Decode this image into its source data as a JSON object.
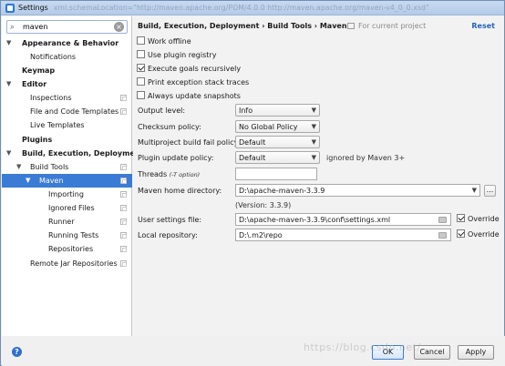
{
  "window": {
    "title": "Settings",
    "title_ghost_text": "xml.schemaLocation=\"http://maven.apache.org/POM/4.0.0 http://maven.apache.org/maven-v4_0_0.xsd\""
  },
  "search": {
    "value": "maven"
  },
  "tree": {
    "appearance_behavior": "Appearance & Behavior",
    "notifications": "Notifications",
    "keymap": "Keymap",
    "editor": "Editor",
    "inspections": "Inspections",
    "file_code_templates": "File and Code Templates",
    "live_templates": "Live Templates",
    "plugins": "Plugins",
    "build_exec_deploy": "Build, Execution, Deployment",
    "build_tools": "Build Tools",
    "maven": "Maven",
    "importing": "Importing",
    "ignored_files": "Ignored Files",
    "runner": "Runner",
    "running_tests": "Running Tests",
    "repositories": "Repositories",
    "remote_jar_repositories": "Remote Jar Repositories"
  },
  "header": {
    "breadcrumb": "Build, Execution, Deployment  ›  Build Tools  ›  Maven",
    "scope": "For current project",
    "reset": "Reset"
  },
  "options": {
    "work_offline": {
      "label": "Work offline",
      "checked": false
    },
    "use_plugin_registry": {
      "label": "Use plugin registry",
      "checked": false
    },
    "execute_goals_recursively": {
      "label": "Execute goals recursively",
      "checked": true
    },
    "print_exception_stack_traces": {
      "label": "Print exception stack traces",
      "checked": false
    },
    "always_update_snapshots": {
      "label": "Always update snapshots",
      "checked": false
    }
  },
  "fields": {
    "output_level": {
      "label": "Output level:",
      "value": "Info"
    },
    "checksum_policy": {
      "label": "Checksum policy:",
      "value": "No Global Policy"
    },
    "multiproject_fail_policy": {
      "label": "Multiproject build fail policy:",
      "value": "Default"
    },
    "plugin_update_policy": {
      "label": "Plugin update policy:",
      "value": "Default",
      "hint": "ignored by Maven 3+"
    },
    "threads": {
      "label": "Threads",
      "hint": "(-T option)",
      "value": ""
    },
    "maven_home": {
      "label": "Maven home directory:",
      "value": "D:\\apache-maven-3.3.9",
      "version": "(Version: 3.3.9)"
    },
    "user_settings": {
      "label": "User settings file:",
      "value": "D:\\apache-maven-3.3.9\\conf\\settings.xml",
      "override_label": "Override",
      "override": true
    },
    "local_repo": {
      "label": "Local repository:",
      "value": "D:\\.m2\\repo",
      "override_label": "Override",
      "override": true
    }
  },
  "buttons": {
    "ok": "OK",
    "cancel": "Cancel",
    "apply": "Apply",
    "help": "?"
  },
  "watermark": "https://blog.csdn.net/...",
  "colors": {
    "selection": "#3a7bd5",
    "link": "#2463b8"
  }
}
